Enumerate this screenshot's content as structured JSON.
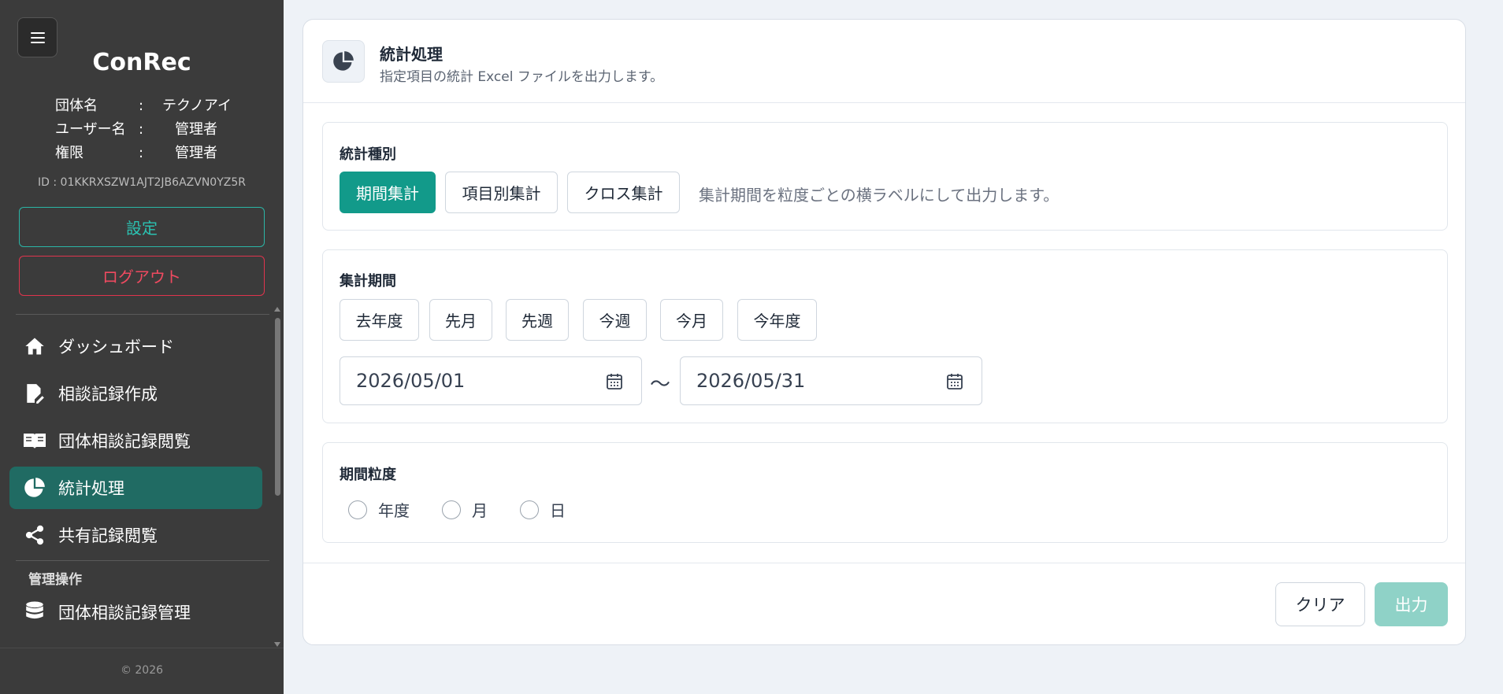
{
  "sidebar": {
    "brand": "ConRec",
    "info": [
      {
        "key": "団体名",
        "sep": ":",
        "value": "テクノアイ"
      },
      {
        "key": "ユーザー名",
        "sep": ":",
        "value": "管理者"
      },
      {
        "key": "権限",
        "sep": ":",
        "value": "管理者"
      }
    ],
    "id_text": "ID : 01KKRXSZW1AJT2JB6AZVN0YZ5R",
    "settings_label": "設定",
    "logout_label": "ログアウト",
    "nav": [
      {
        "label": "ダッシュボード",
        "icon": "home-icon"
      },
      {
        "label": "相談記録作成",
        "icon": "edit-document-icon"
      },
      {
        "label": "団体相談記録閲覧",
        "icon": "open-book-icon"
      },
      {
        "label": "統計処理",
        "icon": "pie-chart-icon",
        "active": true
      },
      {
        "label": "共有記録閲覧",
        "icon": "share-icon"
      }
    ],
    "section_label": "管理操作",
    "admin_nav": [
      {
        "label": "団体相談記録管理",
        "icon": "database-icon"
      }
    ],
    "copyright": "© 2026"
  },
  "header": {
    "title": "統計処理",
    "subtitle": "指定項目の統計 Excel ファイルを出力します。"
  },
  "stat_type": {
    "label": "統計種別",
    "options": [
      "期間集計",
      "項目別集計",
      "クロス集計"
    ],
    "selected": "期間集計",
    "hint": "集計期間を粒度ごとの横ラベルにして出力します。"
  },
  "period": {
    "label": "集計期間",
    "presets": [
      "去年度",
      "先月",
      "先週",
      "今週",
      "今月",
      "今年度"
    ],
    "start_date": "2026/05/01",
    "separator": "〜",
    "end_date": "2026/05/31"
  },
  "granularity": {
    "label": "期間粒度",
    "options": [
      "年度",
      "月",
      "日"
    ]
  },
  "actions": {
    "clear_label": "クリア",
    "output_label": "出力"
  },
  "colors": {
    "accent": "#129a8a",
    "sidebar_bg": "#3b3b3b",
    "active_nav": "#206b63",
    "logout": "#e0344d"
  }
}
